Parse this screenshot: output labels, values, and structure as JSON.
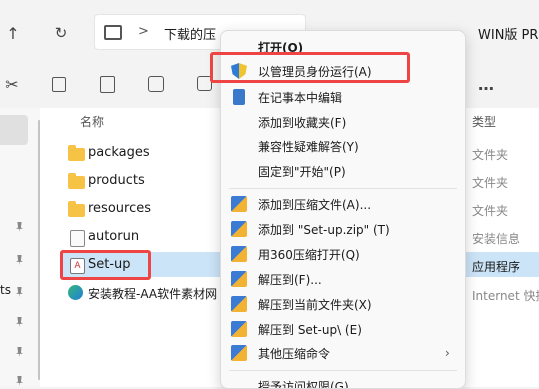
{
  "address": {
    "path_label": "下载的压",
    "right_label": "WIN版 PR",
    "separator": ">"
  },
  "columns": {
    "name": "名称",
    "type": "类型"
  },
  "nav_stub": "ts",
  "files": [
    {
      "name": "packages",
      "type": "文件夹",
      "icon": "folder-icon"
    },
    {
      "name": "products",
      "type": "文件夹",
      "icon": "folder-icon"
    },
    {
      "name": "resources",
      "type": "文件夹",
      "icon": "folder-icon"
    },
    {
      "name": "autorun",
      "type": "安装信息",
      "icon": "settings-file-icon"
    },
    {
      "name": "Set-up",
      "type": "应用程序",
      "icon": "installer-icon"
    },
    {
      "name": "安装教程-AA软件素材网",
      "type": "Internet 快捷",
      "icon": "edge-icon"
    }
  ],
  "context_menu": {
    "open": "打开(O)",
    "run_as_admin": "以管理员身份运行(A)",
    "edit_notepad": "在记事本中编辑",
    "add_favorites": "添加到收藏夹(F)",
    "compat": "兼容性疑难解答(Y)",
    "pin_start": "固定到\"开始\"(P)",
    "add_archive": "添加到压缩文件(A)...",
    "add_zip": "添加到 \"Set-up.zip\" (T)",
    "open_360": "用360压缩打开(Q)",
    "extract_to": "解压到(F)...",
    "extract_here": "解压到当前文件夹(X)",
    "extract_folder": "解压到 Set-up\\ (E)",
    "other_cmds": "其他压缩命令",
    "grant_access": "授予访问权限(G)"
  },
  "colors": {
    "highlight": "#cce4f7",
    "red_outline": "#e44444",
    "folder": "#f6c344"
  }
}
